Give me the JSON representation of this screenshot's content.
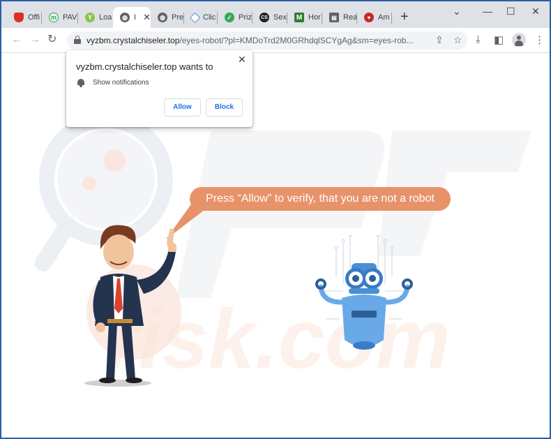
{
  "tabs": [
    {
      "title": "Offi",
      "favicon": "shield-icon",
      "color": "#d93025"
    },
    {
      "title": "PAV",
      "favicon": "lynx-icon",
      "color": "#34a853"
    },
    {
      "title": "Loa",
      "favicon": "y-circle-icon",
      "color": "#8bc34a"
    },
    {
      "title": "I",
      "favicon": "globe-icon",
      "color": "#5f6368",
      "active": true
    },
    {
      "title": "Pre",
      "favicon": "globe-icon",
      "color": "#5f6368"
    },
    {
      "title": "Clic",
      "favicon": "diamond-icon",
      "color": "#4a90d9"
    },
    {
      "title": "Priz",
      "favicon": "check-circle-icon",
      "color": "#34a853"
    },
    {
      "title": "Sex",
      "favicon": "cs-icon",
      "color": "#202124"
    },
    {
      "title": "Hor",
      "favicon": "m-icon",
      "color": "#2e7d32"
    },
    {
      "title": "Rea",
      "favicon": "reader-icon",
      "color": "#5f6368"
    },
    {
      "title": "Am",
      "favicon": "heart-icon",
      "color": "#c62828"
    }
  ],
  "address_bar": {
    "url_host": "vyzbm.crystalchiseler.top",
    "url_path": "/eyes-robot/?pl=KMDoTrd2M0GRhdqlSCYgAg&sm=eyes-rob..."
  },
  "prompt": {
    "title": "vyzbm.crystalchiseler.top wants to",
    "permission": "Show notifications",
    "allow_label": "Allow",
    "block_label": "Block"
  },
  "page": {
    "bubble_text": "Press “Allow” to verify, that you are not a robot"
  },
  "colors": {
    "bubble": "#e8926a",
    "frame": "#2b5fa8",
    "link_blue": "#1a73e8"
  }
}
